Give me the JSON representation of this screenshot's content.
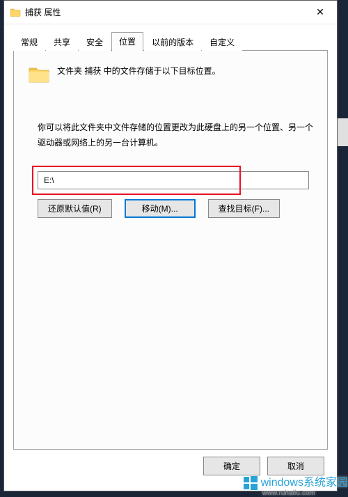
{
  "titlebar": {
    "title": "捕获 属性",
    "close_label": "✕"
  },
  "tabs": [
    {
      "label": "常规"
    },
    {
      "label": "共享"
    },
    {
      "label": "安全"
    },
    {
      "label": "位置",
      "active": true
    },
    {
      "label": "以前的版本"
    },
    {
      "label": "自定义"
    }
  ],
  "content": {
    "header_text": "文件夹 捕获 中的文件存储于以下目标位置。",
    "desc_text": "你可以将此文件夹中文件存储的位置更改为此硬盘上的另一个位置、另一个驱动器或网络上的另一台计算机。",
    "path_value": "E:\\",
    "buttons": {
      "restore": "还原默认值(R)",
      "move": "移动(M)...",
      "find": "查找目标(F)..."
    }
  },
  "footer": {
    "ok": "确定",
    "cancel": "取消"
  },
  "watermark": {
    "text": "windows系统家园",
    "url": "www.ruhaifu.com"
  },
  "colors": {
    "accent": "#0078d7",
    "highlight_red": "#e81123"
  }
}
